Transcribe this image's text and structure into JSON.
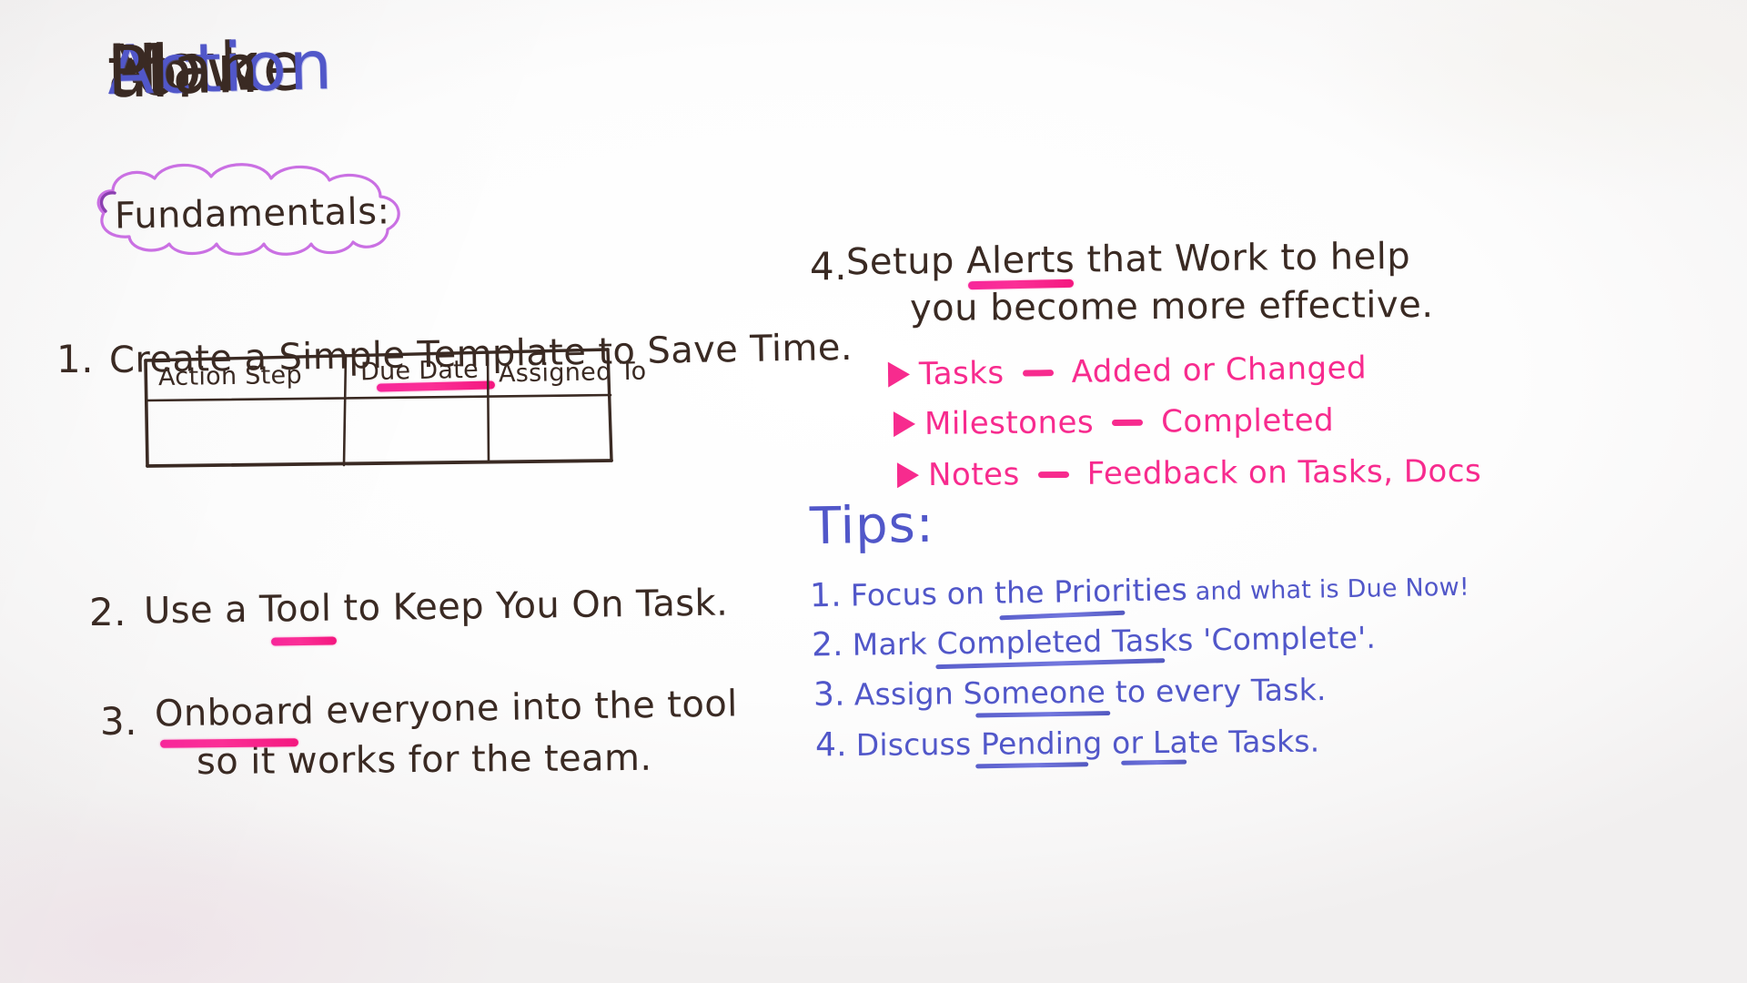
{
  "board": {
    "background_color": "#ffffff",
    "ink_colors": {
      "brown": "#3a2a23",
      "blue": "#5157c9",
      "pink": "#f72b8e",
      "purple": "#c768e2"
    }
  },
  "title": {
    "words": [
      "How",
      "to",
      "Make",
      "an",
      "Action",
      "Plan"
    ],
    "how": "How",
    "to": "to",
    "make": "Make",
    "an": "an",
    "action": "Action",
    "plan": "Plan"
  },
  "left": {
    "cloud_label": "Fundamentals:",
    "items": [
      {
        "number": "1.",
        "line1": "Create a Simple Template to Save Time.",
        "underlined": "Template",
        "underline_color": "#f72b8e"
      },
      {
        "number": "2.",
        "line1": "Use a Tool to Keep You On Task.",
        "underlined": "Tool",
        "underline_color": "#f72b8e"
      },
      {
        "number": "3.",
        "line1": "Onboard everyone  into the tool",
        "line2": "so  it works  for  the team.",
        "underlined": "Onboard",
        "underline_color": "#f72b8e"
      }
    ],
    "table": {
      "headers": [
        "Action Step",
        "Due Date",
        "Assigned To"
      ],
      "rows": [
        [
          "",
          "",
          ""
        ]
      ]
    }
  },
  "right": {
    "item4": {
      "number": "4.",
      "line1": "Setup Alerts  that Work to help",
      "line2": "you become more effective.",
      "underlined": "Alerts",
      "underline_color": "#f72b8e"
    },
    "alert_bullets": [
      {
        "label": "Tasks",
        "value": "Added or Changed"
      },
      {
        "label": "Milestones",
        "value": "Completed"
      },
      {
        "label": "Notes",
        "value": "Feedback on Tasks, Docs"
      }
    ],
    "tips_title": "Tips:",
    "tips": [
      {
        "number": "1.",
        "text_before": "Focus on the ",
        "underlined": "Priorities",
        "text_after": " and what is Due Now!"
      },
      {
        "number": "2.",
        "text_before": "Mark ",
        "underlined": "Completed Tasks",
        "text_after": " 'Complete'."
      },
      {
        "number": "3.",
        "text_before": "Assign ",
        "underlined": "Someone",
        "text_after": " to every Task."
      },
      {
        "number": "4.",
        "text_before": "Discuss ",
        "underlined": "Pending",
        "text_mid": " or ",
        "underlined2": "Late",
        "text_after": " Tasks."
      }
    ]
  }
}
